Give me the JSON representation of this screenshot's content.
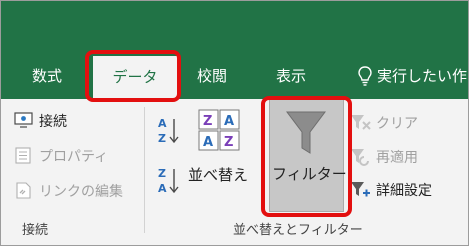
{
  "tabs": {
    "formulas": "数式",
    "data": "データ",
    "review": "校閲",
    "view": "表示",
    "tell_me": "実行したい作"
  },
  "connections": {
    "connections_label": "接続",
    "properties_label": "プロパティ",
    "edit_links_label": "リンクの編集",
    "group_label": "接続"
  },
  "sort_filter": {
    "sort_label": "並べ替え",
    "filter_label": "フィルター",
    "clear_label": "クリア",
    "reapply_label": "再適用",
    "advanced_label": "詳細設定",
    "group_label": "並べ替えとフィルター",
    "az_top": "A",
    "az_bottom": "Z",
    "za_top": "Z",
    "za_bottom": "A"
  },
  "colors": {
    "ribbon_green": "#217346",
    "highlight_red": "#e30f0f",
    "filter_pressed": "#c7c7c7"
  }
}
